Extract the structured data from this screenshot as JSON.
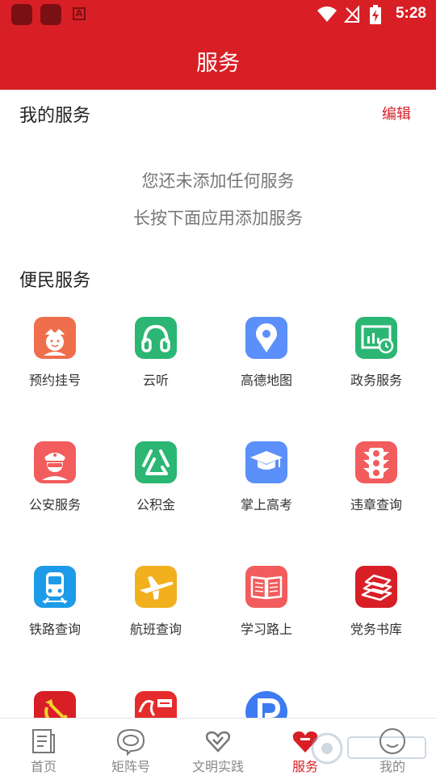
{
  "status_bar": {
    "time": "5:28"
  },
  "header": {
    "title": "服务"
  },
  "my_services": {
    "title": "我的服务",
    "edit_label": "编辑",
    "empty_line1": "您还未添加任何服务",
    "empty_line2": "长按下面应用添加服务"
  },
  "convenience": {
    "title": "便民服务",
    "items": [
      {
        "label": "预约挂号",
        "icon": "nurse-icon",
        "color": "#ef6f4d"
      },
      {
        "label": "云听",
        "icon": "headphones-icon",
        "color": "#2bb673"
      },
      {
        "label": "高德地图",
        "icon": "map-pin-icon",
        "color": "#5b8ff9"
      },
      {
        "label": "政务服务",
        "icon": "gov-screen-icon",
        "color": "#2bb673"
      },
      {
        "label": "公安服务",
        "icon": "police-icon",
        "color": "#f25c5c"
      },
      {
        "label": "公积金",
        "icon": "fund-icon",
        "color": "#2bb673"
      },
      {
        "label": "掌上高考",
        "icon": "graduation-cap-icon",
        "color": "#5b8ff9"
      },
      {
        "label": "违章查询",
        "icon": "traffic-light-icon",
        "color": "#f25c5c"
      },
      {
        "label": "铁路查询",
        "icon": "train-icon",
        "color": "#1e9be8"
      },
      {
        "label": "航班查询",
        "icon": "airplane-icon",
        "color": "#f2b01e"
      },
      {
        "label": "学习路上",
        "icon": "open-book-icon",
        "color": "#f25c5c"
      },
      {
        "label": "党务书库",
        "icon": "book-stack-icon",
        "color": "#d81f26"
      },
      {
        "label": "",
        "icon": "party-emblem-icon",
        "color": "#d81f26"
      },
      {
        "label": "",
        "icon": "xuexi-qiangguo-icon",
        "color": "#e52b2b"
      },
      {
        "label": "",
        "icon": "parking-icon",
        "color": "#3d7bf0"
      }
    ]
  },
  "tabbar": {
    "tabs": [
      {
        "label": "首页",
        "icon": "news-icon"
      },
      {
        "label": "矩阵号",
        "icon": "eye-bubble-icon"
      },
      {
        "label": "文明实践",
        "icon": "heart-icon"
      },
      {
        "label": "服务",
        "icon": "service-heart-icon",
        "active": true
      },
      {
        "label": "我的",
        "icon": "user-icon"
      }
    ]
  },
  "colors": {
    "brand": "#d81f26",
    "tab_inactive": "#888888"
  }
}
